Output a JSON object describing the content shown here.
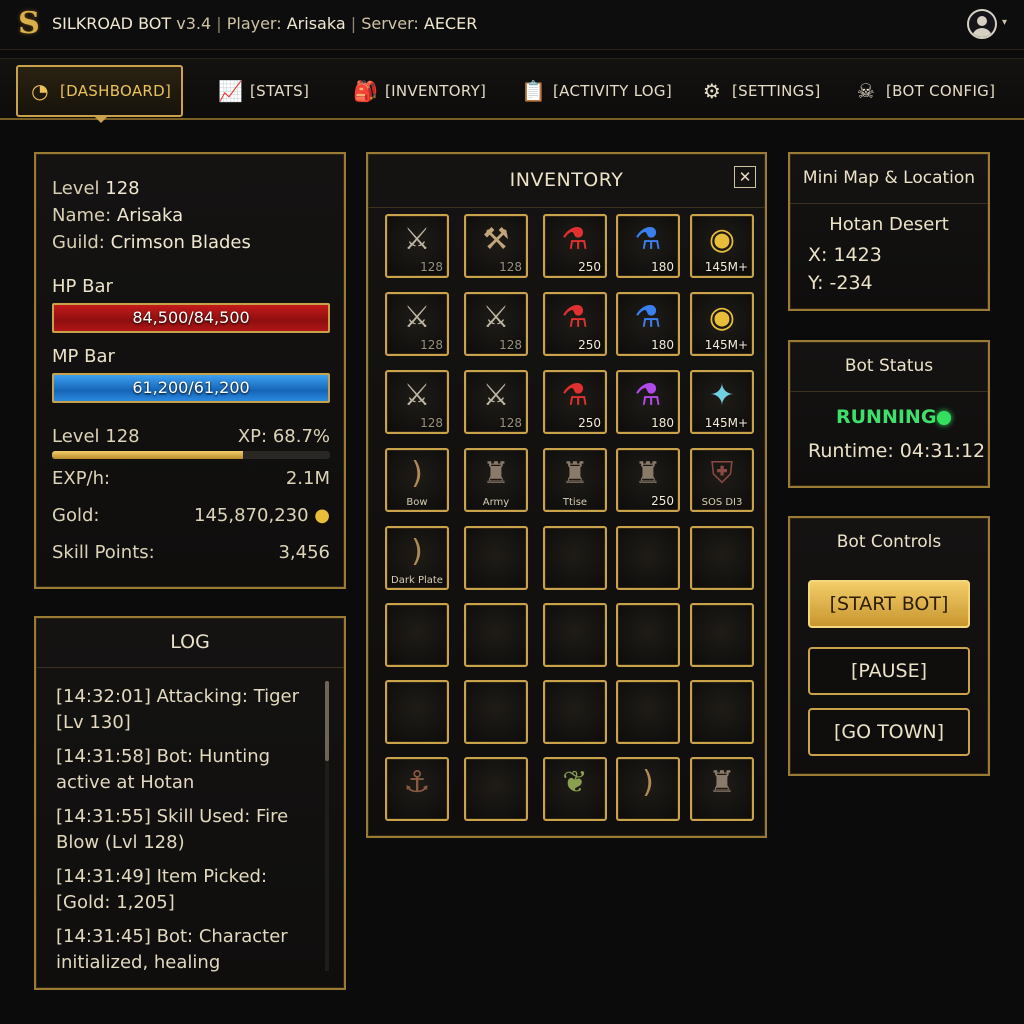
{
  "app": {
    "logo": "S",
    "name": "SILKROAD BOT",
    "version": "v3.4",
    "player_label": "Player:",
    "player": "Arisaka",
    "server_label": "Server:",
    "server": "AECER",
    "separator": "|"
  },
  "nav": {
    "tabs": [
      {
        "label": "[DASHBOARD]",
        "icon": "speedometer-icon",
        "active": true
      },
      {
        "label": "[STATS]",
        "icon": "bar-chart-icon"
      },
      {
        "label": "[INVENTORY]",
        "icon": "backpack-icon"
      },
      {
        "label": "[ACTIVITY LOG]",
        "icon": "clipboard-icon"
      },
      {
        "label": "[SETTINGS]",
        "icon": "gear-icon"
      },
      {
        "label": "[BOT CONFIG]",
        "icon": "robot-icon"
      }
    ]
  },
  "character": {
    "level_label": "Level",
    "level": "128",
    "name_label": "Name:",
    "name": "Arisaka",
    "guild_label": "Guild:",
    "guild": "Crimson Blades",
    "hp_label": "HP Bar",
    "hp": "84,500/84,500",
    "hp_fraction": 1.0,
    "mp_label": "MP Bar",
    "mp": "61,200/61,200",
    "mp_fraction": 1.0,
    "level_row": "Level 128",
    "xp_label": "XP:",
    "xp": "68.7%",
    "xp_fraction": 0.687,
    "exph_label": "EXP/h:",
    "exph": "2.1M",
    "gold_label": "Gold:",
    "gold": "145,870,230",
    "sp_label": "Skill Points:",
    "sp": "3,456"
  },
  "log": {
    "title": "LOG",
    "entries": [
      "[14:32:01] Attacking: Tiger [Lv 130]",
      "[14:31:58] Bot: Hunting active at Hotan",
      "[14:31:55] Skill Used: Fire Blow (Lvl 128)",
      "[14:31:49] Item Picked: [Gold: 1,205]",
      "[14:31:45] Bot: Character initialized, healing"
    ]
  },
  "inventory": {
    "title": "INVENTORY",
    "close": "✕",
    "slots": [
      {
        "icon": "sword-icon",
        "qty": "128",
        "dim": true
      },
      {
        "icon": "axe-icon",
        "qty": "128",
        "dim": true
      },
      {
        "icon": "red-potion-icon",
        "qty": "250"
      },
      {
        "icon": "blue-potion-icon",
        "qty": "180"
      },
      {
        "icon": "gold-coins-icon",
        "qty": "145M+"
      },
      {
        "icon": "sword-icon",
        "qty": "128",
        "dim": true
      },
      {
        "icon": "sword-icon",
        "qty": "128",
        "dim": true
      },
      {
        "icon": "red-potion-icon",
        "qty": "250"
      },
      {
        "icon": "blue-potion-icon",
        "qty": "180"
      },
      {
        "icon": "gold-coins-icon",
        "qty": "145M+"
      },
      {
        "icon": "sword-icon",
        "qty": "128",
        "dim": true
      },
      {
        "icon": "sword-icon",
        "qty": "128",
        "dim": true
      },
      {
        "icon": "red-potion-icon",
        "qty": "250"
      },
      {
        "icon": "purple-potion-icon",
        "qty": "180"
      },
      {
        "icon": "crystal-icon",
        "qty": "145M+"
      },
      {
        "icon": "bow-icon",
        "name": "Bow"
      },
      {
        "icon": "armor-icon",
        "name": "Army"
      },
      {
        "icon": "armor-icon",
        "name": "Ttise"
      },
      {
        "icon": "armor-icon",
        "qty": "250"
      },
      {
        "icon": "shield-icon",
        "name": "SOS DI3"
      },
      {
        "icon": "bow-icon",
        "name": "Dark Plate"
      },
      {
        "icon": ""
      },
      {
        "icon": ""
      },
      {
        "icon": ""
      },
      {
        "icon": ""
      },
      {
        "icon": ""
      },
      {
        "icon": ""
      },
      {
        "icon": ""
      },
      {
        "icon": ""
      },
      {
        "icon": ""
      },
      {
        "icon": ""
      },
      {
        "icon": ""
      },
      {
        "icon": ""
      },
      {
        "icon": ""
      },
      {
        "icon": ""
      },
      {
        "icon": "boots-icon"
      },
      {
        "icon": ""
      },
      {
        "icon": "feather-icon"
      },
      {
        "icon": "bow-icon"
      },
      {
        "icon": "armor-icon"
      }
    ]
  },
  "minimap": {
    "title": "Mini Map & Location",
    "location": "Hotan Desert",
    "x": "X: 1423",
    "y": "Y: -234"
  },
  "status": {
    "title": "Bot Status",
    "state": "RUNNING",
    "runtime": "Runtime: 04:31:12"
  },
  "controls": {
    "title": "Bot Controls",
    "start": "[START BOT]",
    "pause": "[PAUSE]",
    "town": "[GO TOWN]"
  },
  "colors": {
    "gold_accent": "#c9a24a",
    "hp": "#b01616",
    "mp": "#2a8ae0",
    "running": "#3ee06a"
  }
}
